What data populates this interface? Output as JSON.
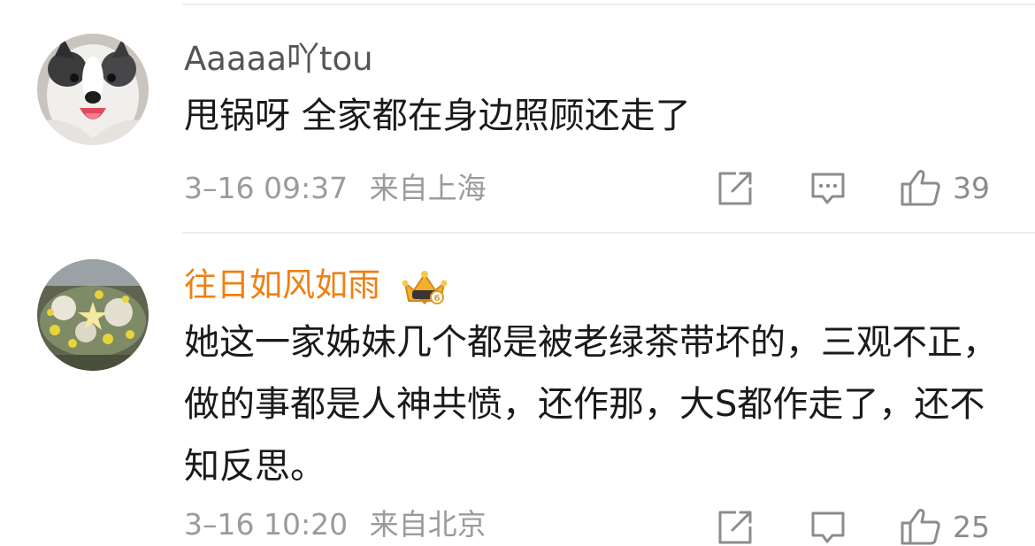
{
  "comments": [
    {
      "username": "Aaaaa吖tou",
      "username_color": "#555555",
      "text": "甩锅呀 全家都在身边照顾还走了",
      "time": "3–16 09:37",
      "location": "来自上海",
      "likes": "39",
      "avatar": "dog-avatar"
    },
    {
      "username": "往日如风如雨",
      "username_color": "#f07f12",
      "text": "她这一家姊妹几个都是被老绿茶带坏的，三观不正，做的事都是人神共愤，还作那，大S都作走了，还不知反思。",
      "time": "3–16 10:20",
      "location": "来自北京",
      "likes": "25",
      "avatar": "flowers-avatar",
      "badge": "vip-crown-badge"
    }
  ],
  "icons": {
    "share": "share-icon",
    "comment": "comment-icon",
    "like": "thumbs-up-icon"
  },
  "colors": {
    "meta_gray": "#9b9b9b",
    "divider": "#eeeeee",
    "accent_orange": "#f07f12"
  }
}
